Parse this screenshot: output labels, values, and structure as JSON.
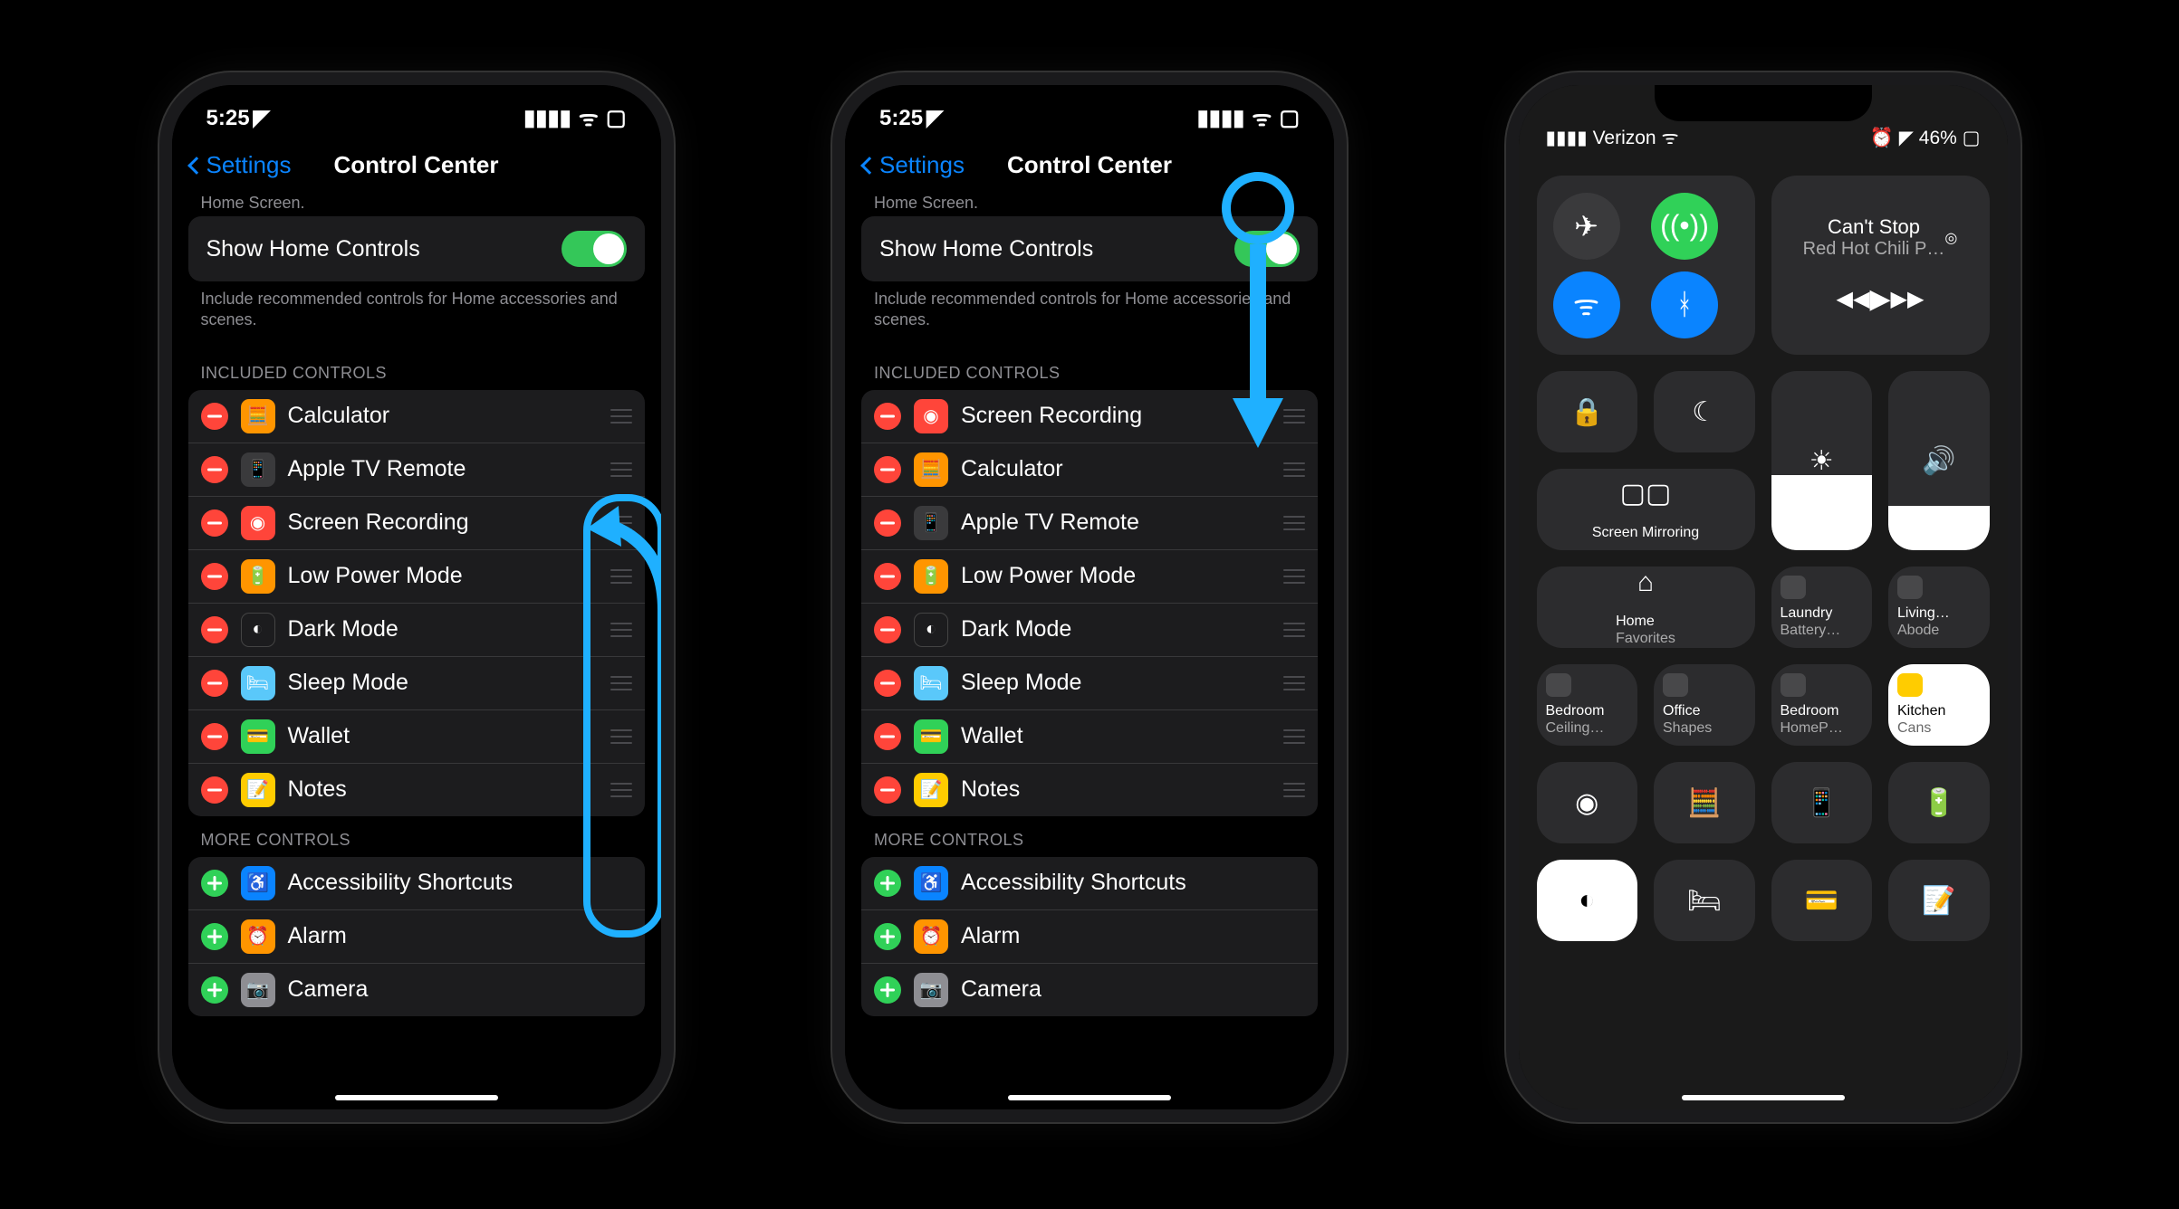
{
  "status": {
    "time": "5:25",
    "carrier": "Verizon",
    "battery": "46%"
  },
  "nav": {
    "back": "Settings",
    "title": "Control Center"
  },
  "truncated": "Home Screen.",
  "homeControls": {
    "label": "Show Home Controls",
    "caption": "Include recommended controls for Home accessories and scenes."
  },
  "sections": {
    "included": "INCLUDED CONTROLS",
    "more": "MORE CONTROLS"
  },
  "included1": [
    {
      "label": "Calculator",
      "ic": "ic-calc",
      "glyph": "🧮"
    },
    {
      "label": "Apple TV Remote",
      "ic": "ic-remote",
      "glyph": "📱"
    },
    {
      "label": "Screen Recording",
      "ic": "ic-record",
      "glyph": "◉"
    },
    {
      "label": "Low Power Mode",
      "ic": "ic-lowpower",
      "glyph": "🔋"
    },
    {
      "label": "Dark Mode",
      "ic": "ic-dark",
      "glyph": "◐"
    },
    {
      "label": "Sleep Mode",
      "ic": "ic-sleep",
      "glyph": "🛏"
    },
    {
      "label": "Wallet",
      "ic": "ic-wallet",
      "glyph": "💳"
    },
    {
      "label": "Notes",
      "ic": "ic-notes",
      "glyph": "📝"
    }
  ],
  "included2": [
    {
      "label": "Screen Recording",
      "ic": "ic-record",
      "glyph": "◉"
    },
    {
      "label": "Calculator",
      "ic": "ic-calc",
      "glyph": "🧮"
    },
    {
      "label": "Apple TV Remote",
      "ic": "ic-remote",
      "glyph": "📱"
    },
    {
      "label": "Low Power Mode",
      "ic": "ic-lowpower",
      "glyph": "🔋"
    },
    {
      "label": "Dark Mode",
      "ic": "ic-dark",
      "glyph": "◐"
    },
    {
      "label": "Sleep Mode",
      "ic": "ic-sleep",
      "glyph": "🛏"
    },
    {
      "label": "Wallet",
      "ic": "ic-wallet",
      "glyph": "💳"
    },
    {
      "label": "Notes",
      "ic": "ic-notes",
      "glyph": "📝"
    }
  ],
  "more": [
    {
      "label": "Accessibility Shortcuts",
      "ic": "ic-access",
      "glyph": "♿"
    },
    {
      "label": "Alarm",
      "ic": "ic-alarm",
      "glyph": "⏰"
    },
    {
      "label": "Camera",
      "ic": "ic-camera",
      "glyph": "📷"
    }
  ],
  "cc": {
    "media": {
      "title": "Can't Stop",
      "artist": "Red Hot Chili P…"
    },
    "mirroring": "Screen Mirroring",
    "home": {
      "line1": "Home",
      "line2": "Favorites"
    },
    "accessories": [
      {
        "line1": "Laundry",
        "line2": "Battery…"
      },
      {
        "line1": "Living…",
        "line2": "Abode"
      },
      {
        "line1": "Bedroom",
        "line2": "Ceiling…"
      },
      {
        "line1": "Office",
        "line2": "Shapes"
      },
      {
        "line1": "Bedroom",
        "line2": "HomeP…"
      },
      {
        "line1": "Kitchen",
        "line2": "Cans"
      }
    ],
    "brightness": 42,
    "volume": 25
  }
}
